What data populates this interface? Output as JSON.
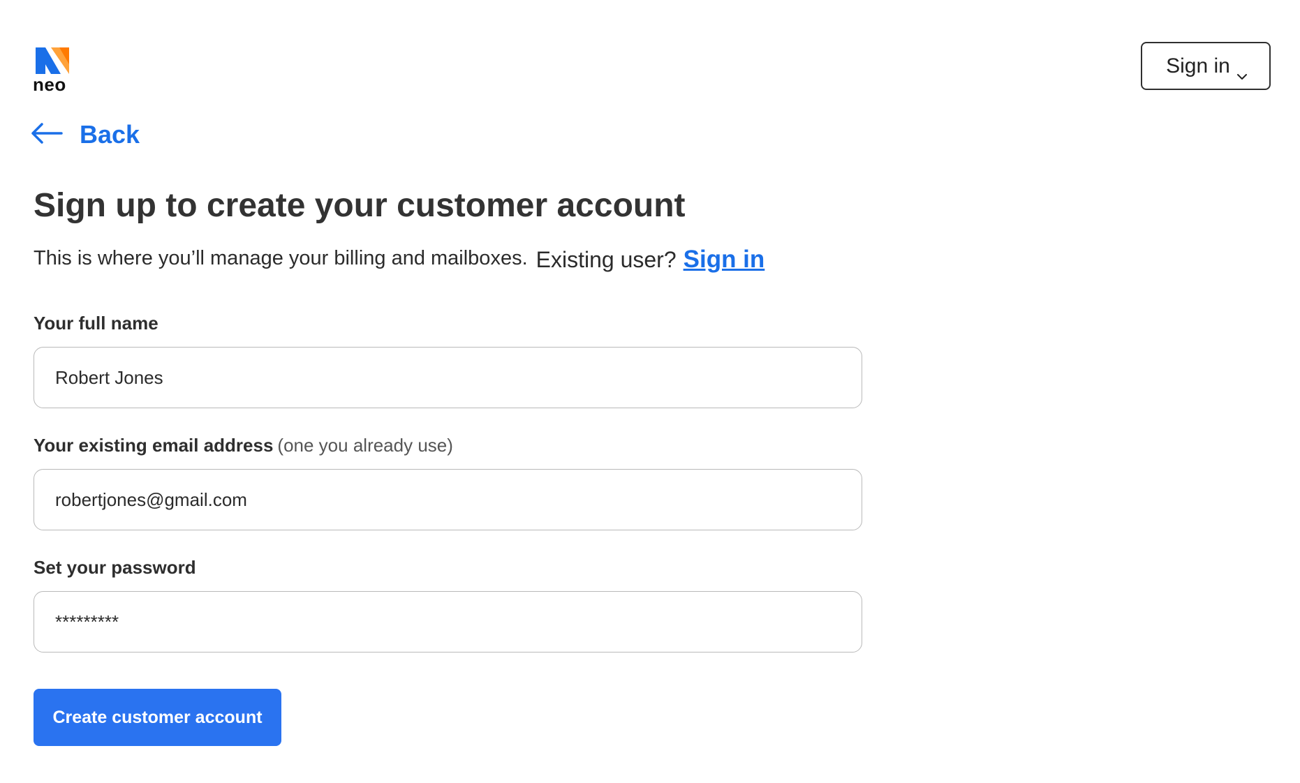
{
  "brand": {
    "name": "neo",
    "icon": "neo-logo-icon",
    "colors": {
      "blue": "#1a6fe8",
      "orange": "#ff7a00"
    }
  },
  "header": {
    "signin_label": "Sign in",
    "signin_icon": "chevron-down-icon"
  },
  "nav": {
    "back_label": "Back",
    "back_icon": "arrow-left-icon"
  },
  "page": {
    "title": "Sign up to create your customer account",
    "subtitle": "This is where you’ll manage your billing and mailboxes.",
    "existing_user": "Existing user?",
    "signin_link": "Sign in"
  },
  "form": {
    "full_name": {
      "label": "Your full name",
      "value": "Robert Jones"
    },
    "email": {
      "label": "Your existing email address",
      "hint": "(one you already use)",
      "value": "robertjones@gmail.com"
    },
    "password": {
      "label": "Set your password",
      "value": "*********"
    },
    "submit_label": "Create customer account"
  },
  "colors": {
    "primary": "#2a73f0",
    "link": "#1a6fe8",
    "text": "#2b2b2b",
    "border": "#b9b9b9"
  }
}
